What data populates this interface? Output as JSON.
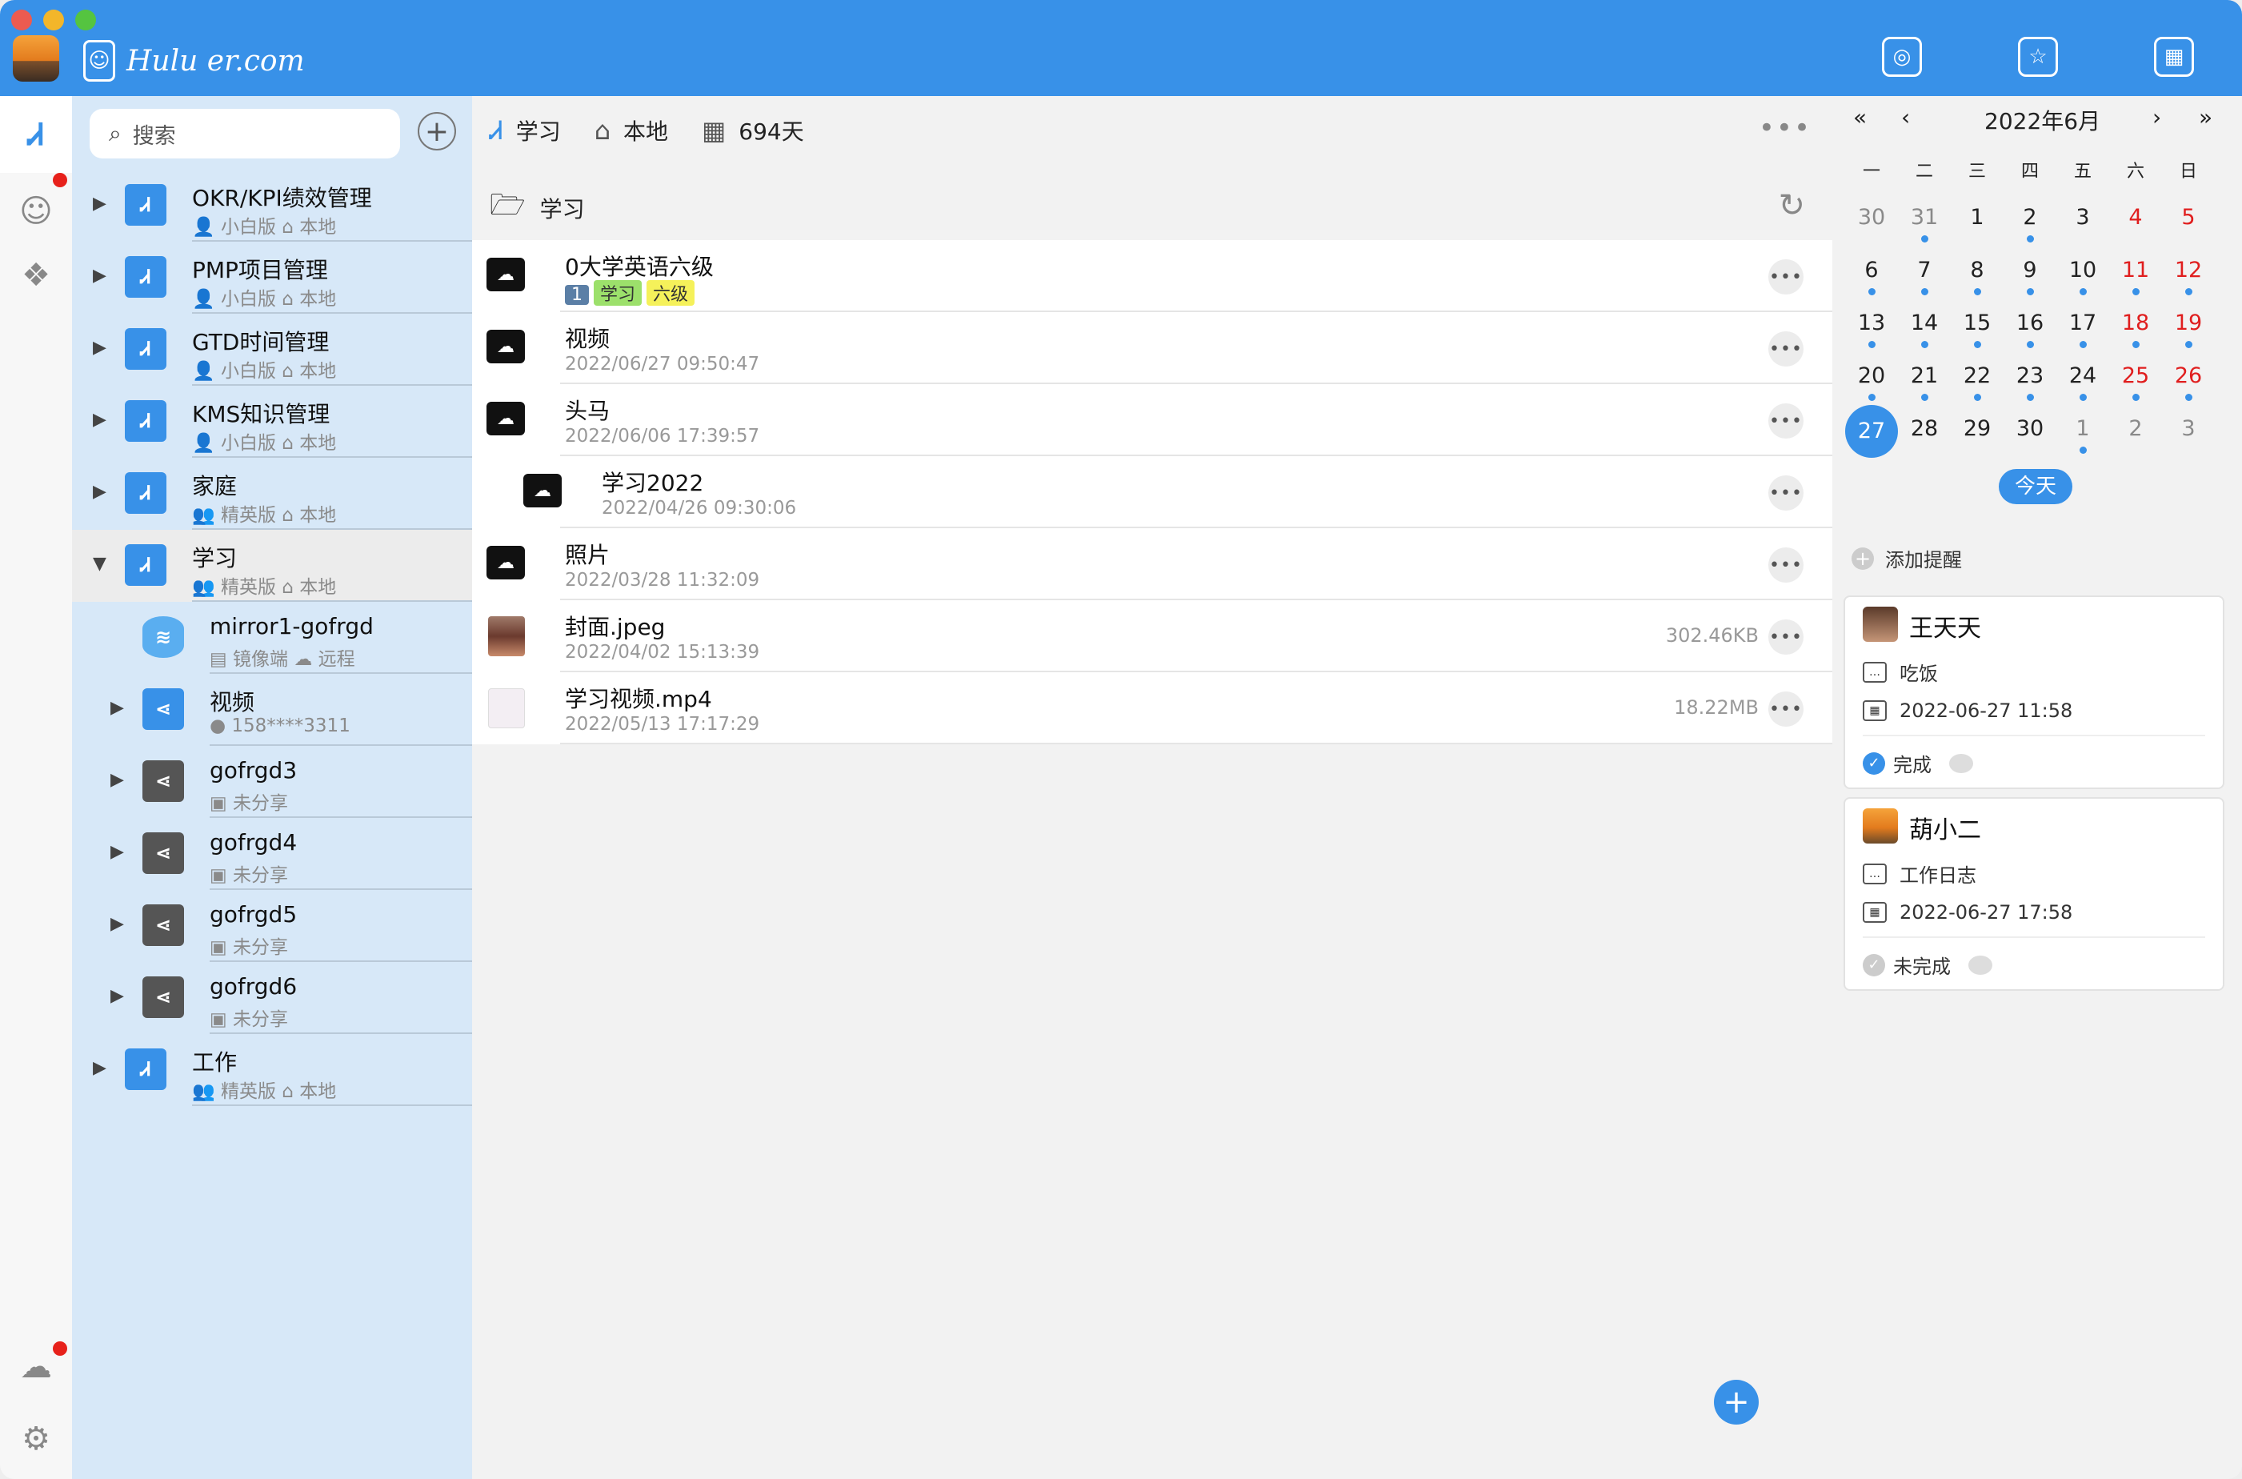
{
  "window": {
    "traffic_lights": [
      "#ec5b50",
      "#f3b62a",
      "#55c440"
    ]
  },
  "brand": {
    "text": "Hulu er.com"
  },
  "topbar": {
    "icons": [
      "search-globe-icon",
      "badge-star-icon",
      "calendar-icon"
    ]
  },
  "rail": {
    "items": [
      "projects-logo-icon",
      "user-icon",
      "apps-icon",
      "cloud-sync-icon",
      "settings-icon"
    ]
  },
  "sidebar": {
    "search_placeholder": "搜索",
    "projects": [
      {
        "title": "OKR/KPI绩效管理",
        "edition": "小白版",
        "location": "本地"
      },
      {
        "title": "PMP项目管理",
        "edition": "小白版",
        "location": "本地"
      },
      {
        "title": "GTD时间管理",
        "edition": "小白版",
        "location": "本地"
      },
      {
        "title": "KMS知识管理",
        "edition": "小白版",
        "location": "本地"
      },
      {
        "title": "家庭",
        "edition": "精英版",
        "location": "本地"
      },
      {
        "title": "学习",
        "edition": "精英版",
        "location": "本地"
      }
    ],
    "children": [
      {
        "title": "mirror1-gofrgd",
        "sub1": "镜像端",
        "sub2": "远程"
      },
      {
        "title": "视频",
        "sub1": "158****3311"
      },
      {
        "title": "gofrgd3",
        "sub1": "未分享"
      },
      {
        "title": "gofrgd4",
        "sub1": "未分享"
      },
      {
        "title": "gofrgd5",
        "sub1": "未分享"
      },
      {
        "title": "gofrgd6",
        "sub1": "未分享"
      }
    ],
    "last": {
      "title": "工作",
      "edition": "精英版",
      "location": "本地"
    }
  },
  "main": {
    "crumbs": {
      "project": "学习",
      "location": "本地",
      "days": "694天"
    },
    "folder": "学习",
    "items": [
      {
        "title": "0大学英语六级",
        "badge": "1",
        "tags": [
          "学习",
          "六级"
        ]
      },
      {
        "title": "视频",
        "date": "2022/06/27 09:50:47"
      },
      {
        "title": "头马",
        "date": "2022/06/06 17:39:57"
      },
      {
        "title": "学习2022",
        "date": "2022/04/26 09:30:06"
      },
      {
        "title": "照片",
        "date": "2022/03/28 11:32:09"
      },
      {
        "title": "封面.jpeg",
        "date": "2022/04/02 15:13:39",
        "size": "302.46KB"
      },
      {
        "title": "学习视频.mp4",
        "date": "2022/05/13 17:17:29",
        "size": "18.22MB"
      }
    ]
  },
  "calendar": {
    "month_label": "2022年6月",
    "nav": [
      "«",
      "‹",
      "›",
      "»"
    ],
    "weekdays": [
      "一",
      "二",
      "三",
      "四",
      "五",
      "六",
      "日"
    ],
    "today_button": "今天",
    "add_reminder": "添加提醒",
    "accent": "#3891e8"
  },
  "reminders": [
    {
      "name": "王天天",
      "task": "吃饭",
      "time": "2022-06-27 11:58",
      "status": "完成"
    },
    {
      "name": "葫小二",
      "task": "工作日志",
      "time": "2022-06-27 17:58",
      "status": "未完成"
    }
  ]
}
